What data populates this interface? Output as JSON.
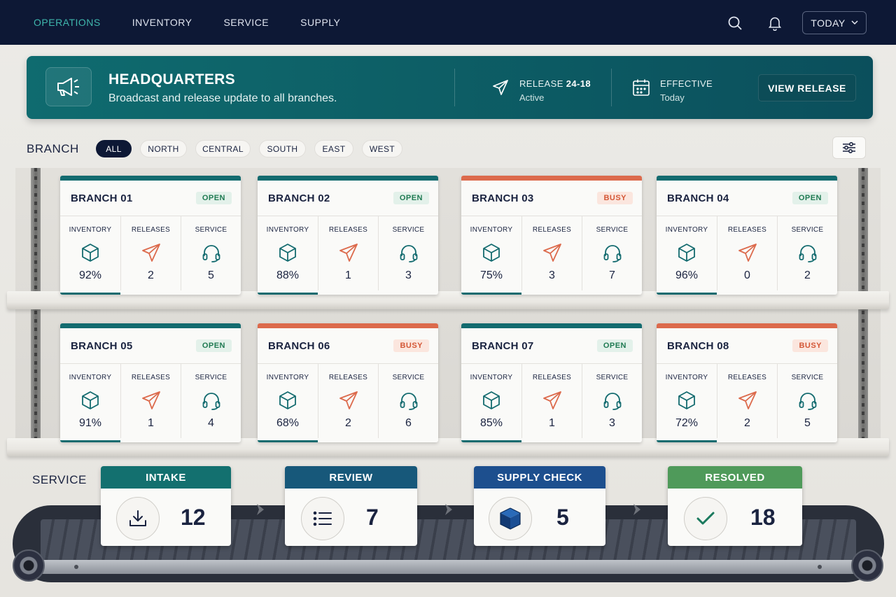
{
  "nav": {
    "items": [
      "OPERATIONS",
      "INVENTORY",
      "SERVICE",
      "SUPPLY"
    ],
    "active": "OPERATIONS",
    "date_button": "TODAY",
    "icons": [
      "search-icon",
      "bell-icon",
      "chevron-down-icon"
    ]
  },
  "banner": {
    "title": "HEADQUARTERS",
    "subtitle": "Broadcast and release update to all branches.",
    "release_label": "RELEASE",
    "release_id": "24-18",
    "release_status": "Active",
    "effective_label": "EFFECTIVE",
    "effective_value": "Today",
    "button": "VIEW RELEASE",
    "icons": [
      "megaphone-icon",
      "send-icon",
      "calendar-icon"
    ]
  },
  "branch_filter": {
    "heading": "BRANCH",
    "chips": [
      "ALL",
      "NORTH",
      "CENTRAL",
      "SOUTH",
      "EAST",
      "WEST"
    ],
    "active": "ALL"
  },
  "metric_labels": [
    "INVENTORY",
    "RELEASES",
    "SERVICE"
  ],
  "branches": [
    {
      "name": "BRANCH 01",
      "status": "OPEN",
      "inventory": "92%",
      "releases": "2",
      "service": "5"
    },
    {
      "name": "BRANCH 02",
      "status": "OPEN",
      "inventory": "88%",
      "releases": "1",
      "service": "3"
    },
    {
      "name": "BRANCH 03",
      "status": "BUSY",
      "inventory": "75%",
      "releases": "3",
      "service": "7"
    },
    {
      "name": "BRANCH 04",
      "status": "OPEN",
      "inventory": "96%",
      "releases": "0",
      "service": "2"
    },
    {
      "name": "BRANCH 05",
      "status": "OPEN",
      "inventory": "91%",
      "releases": "1",
      "service": "4"
    },
    {
      "name": "BRANCH 06",
      "status": "BUSY",
      "inventory": "68%",
      "releases": "2",
      "service": "6"
    },
    {
      "name": "BRANCH 07",
      "status": "OPEN",
      "inventory": "85%",
      "releases": "1",
      "service": "3"
    },
    {
      "name": "BRANCH 08",
      "status": "BUSY",
      "inventory": "72%",
      "releases": "2",
      "service": "5"
    }
  ],
  "service": {
    "heading": "SERVICE",
    "stages": [
      {
        "label": "INTAKE",
        "count": "12",
        "color": "#13706f",
        "icon": "download-icon"
      },
      {
        "label": "REVIEW",
        "count": "7",
        "color": "#17587a",
        "icon": "list-icon"
      },
      {
        "label": "SUPPLY CHECK",
        "count": "5",
        "color": "#1d4f8e",
        "icon": "box-icon"
      },
      {
        "label": "RESOLVED",
        "count": "18",
        "color": "#4f9a5a",
        "icon": "check-icon"
      }
    ]
  },
  "colors": {
    "nav_bg": "#0d1835",
    "accent_teal": "#136b6f",
    "busy_orange": "#dc6a4c",
    "open_green": "#1f7a52"
  }
}
